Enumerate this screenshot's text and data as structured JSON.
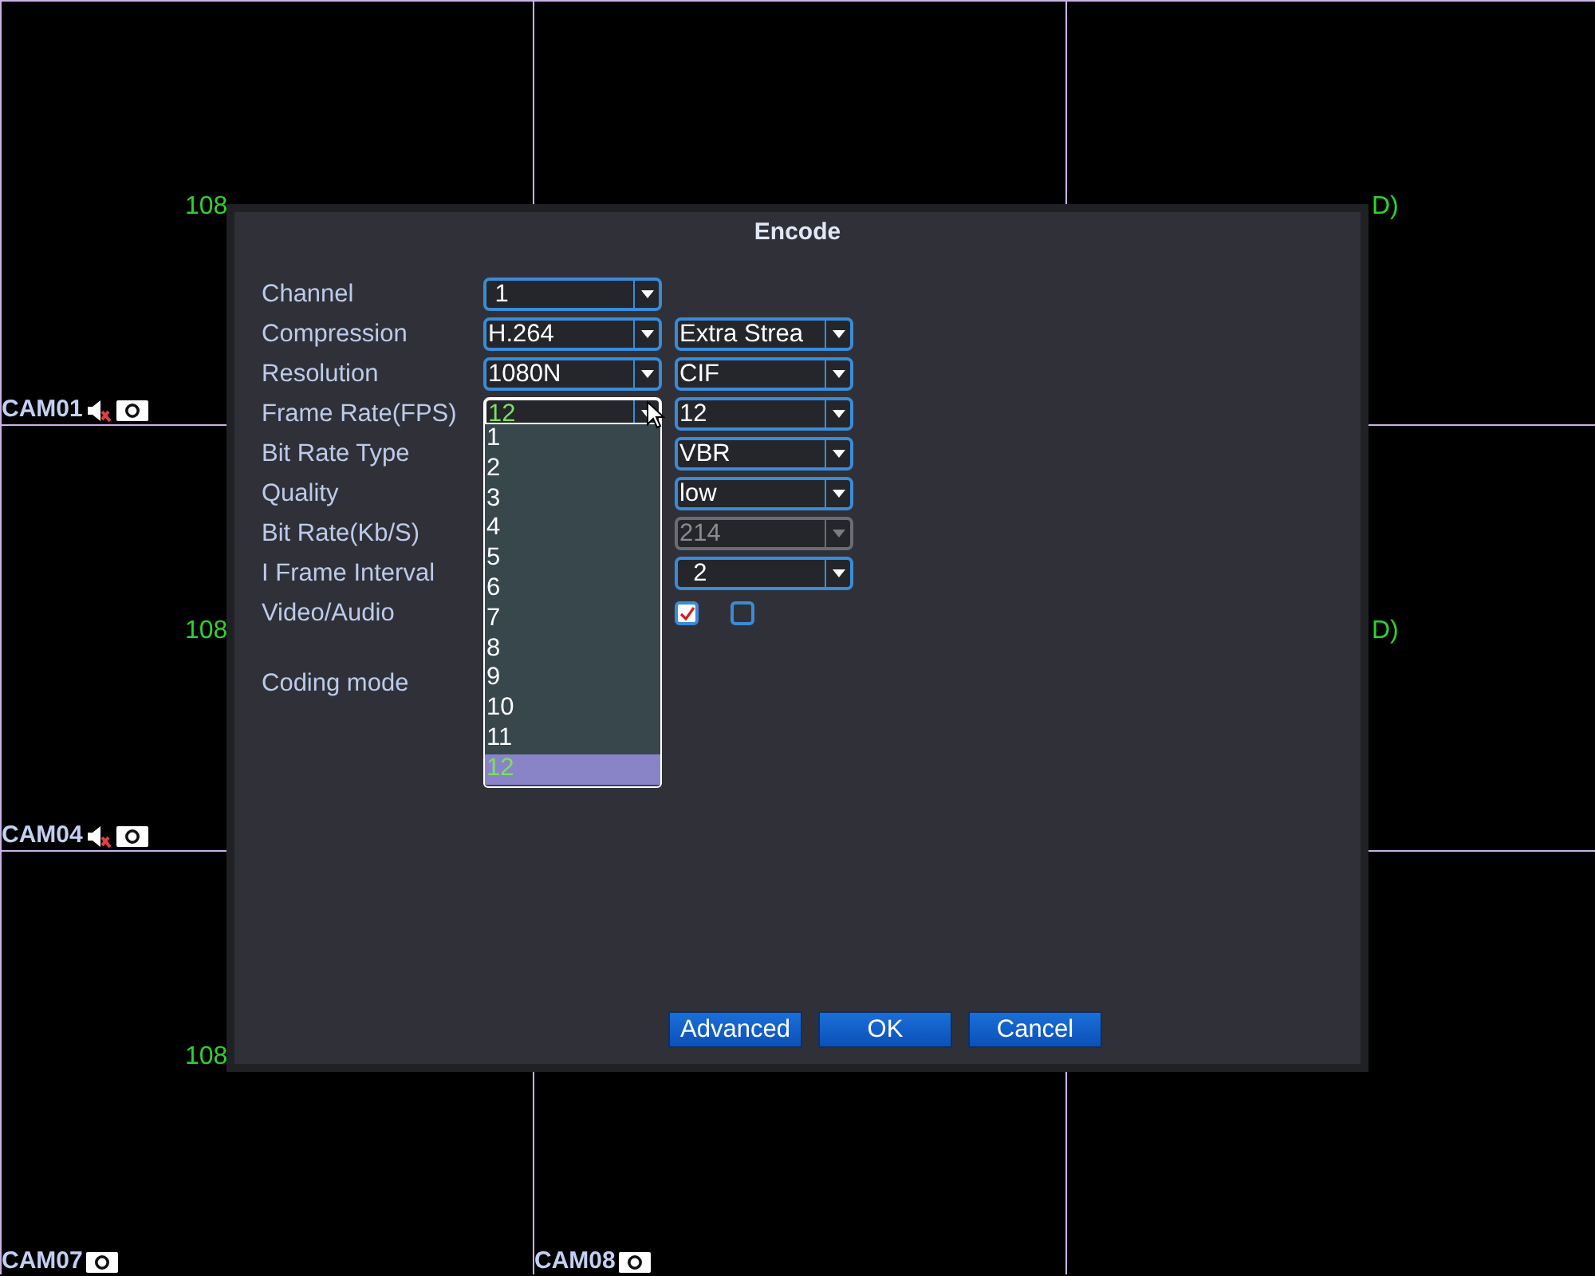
{
  "cells": [
    {
      "overlay": {
        "text": "108",
        "kind": "cut-right"
      },
      "camera": "CAM01",
      "icons": [
        {
          "kind": "speaker-muted"
        },
        {
          "kind": "record"
        }
      ]
    },
    {},
    {
      "overlay": {
        "text": "D)",
        "kind": "cut-left"
      }
    },
    {
      "overlay": {
        "text": "108",
        "kind": "cut-right"
      },
      "camera": "CAM04",
      "icons": [
        {
          "kind": "speaker-muted"
        },
        {
          "kind": "record"
        }
      ]
    },
    {},
    {
      "overlay": {
        "text": "D)",
        "kind": "cut-left"
      }
    },
    {
      "overlay": {
        "text": "108",
        "kind": "cut-right"
      },
      "camera": "CAM07",
      "icons": [
        {
          "kind": "record"
        }
      ]
    },
    {
      "camera": "CAM08",
      "icons": [
        {
          "kind": "record"
        }
      ]
    },
    {}
  ],
  "dialog": {
    "title": "Encode",
    "rows": [
      {
        "label": "Channel",
        "fields": [
          {
            "kind": "select",
            "value": " 1",
            "focused": false,
            "disabled": false
          }
        ]
      },
      {
        "label": "Compression",
        "fields": [
          {
            "kind": "select",
            "value": "H.264",
            "focused": false,
            "disabled": false
          },
          {
            "kind": "select",
            "value": "Extra Strea",
            "focused": false,
            "disabled": false
          }
        ]
      },
      {
        "label": "Resolution",
        "fields": [
          {
            "kind": "select",
            "value": "1080N",
            "focused": false,
            "disabled": false
          },
          {
            "kind": "select",
            "value": "CIF",
            "focused": false,
            "disabled": false
          }
        ]
      },
      {
        "label": "Frame Rate(FPS)",
        "fields": [
          {
            "kind": "select",
            "value": "12",
            "focused": true,
            "disabled": false
          },
          {
            "kind": "select",
            "value": "12",
            "focused": false,
            "disabled": false
          }
        ]
      },
      {
        "label": "Bit Rate Type",
        "fields": [
          {
            "kind": "covered"
          },
          {
            "kind": "select",
            "value": "VBR",
            "focused": false,
            "disabled": false
          }
        ]
      },
      {
        "label": "Quality",
        "fields": [
          {
            "kind": "covered"
          },
          {
            "kind": "select",
            "value": "low",
            "focused": false,
            "disabled": false
          }
        ]
      },
      {
        "label": "Bit Rate(Kb/S)",
        "fields": [
          {
            "kind": "covered"
          },
          {
            "kind": "select",
            "value": "214",
            "focused": false,
            "disabled": true
          }
        ]
      },
      {
        "label": "I Frame Interval",
        "fields": [
          {
            "kind": "covered"
          },
          {
            "kind": "select",
            "value": "  2",
            "focused": false,
            "disabled": false
          }
        ]
      },
      {
        "label": "Video/Audio",
        "fields": [
          {
            "kind": "covered"
          },
          {
            "kind": "checkbox",
            "checked": true
          },
          {
            "kind": "checkbox",
            "checked": false
          }
        ]
      },
      {
        "label": "Coding mode",
        "fields": []
      }
    ],
    "dropdown": {
      "items": [
        {
          "label": "1",
          "selected": false
        },
        {
          "label": "2",
          "selected": false
        },
        {
          "label": "3",
          "selected": false
        },
        {
          "label": "4",
          "selected": false
        },
        {
          "label": "5",
          "selected": false
        },
        {
          "label": "6",
          "selected": false
        },
        {
          "label": "7",
          "selected": false
        },
        {
          "label": "8",
          "selected": false
        },
        {
          "label": "9",
          "selected": false
        },
        {
          "label": "10",
          "selected": false
        },
        {
          "label": "11",
          "selected": false
        },
        {
          "label": "12",
          "selected": true
        }
      ]
    },
    "buttons": [
      "Advanced",
      "OK",
      "Cancel"
    ]
  }
}
